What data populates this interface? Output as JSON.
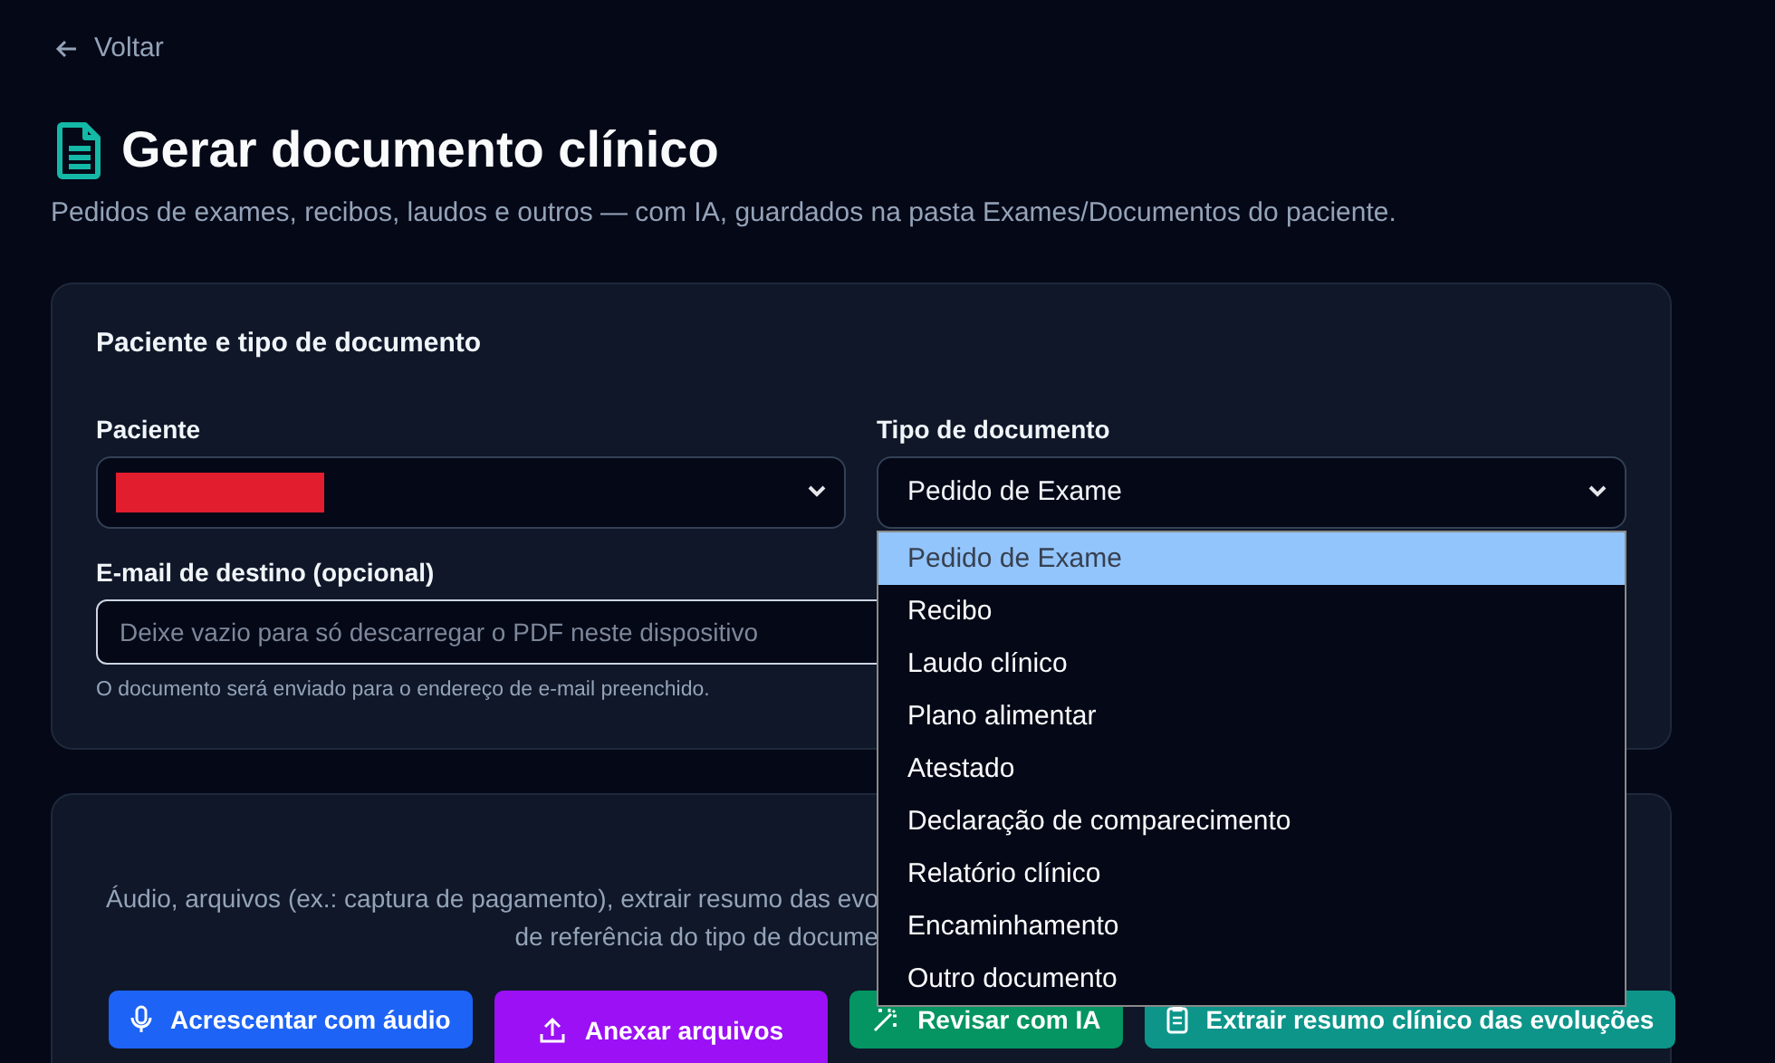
{
  "back_link": {
    "label": "Voltar"
  },
  "title": "Gerar documento clínico",
  "subtitle": "Pedidos de exames, recibos, laudos e outros — com IA, guardados na pasta Exames/Documentos do paciente.",
  "patient_section": {
    "heading": "Paciente e tipo de documento",
    "patient_field": {
      "label": "Paciente",
      "redacted": true
    },
    "type_field": {
      "label": "Tipo de documento",
      "value": "Pedido de Exame",
      "expanded": true,
      "options": [
        {
          "label": "Pedido de Exame",
          "selected": true
        },
        {
          "label": "Recibo",
          "selected": false
        },
        {
          "label": "Laudo clínico",
          "selected": false
        },
        {
          "label": "Plano alimentar",
          "selected": false
        },
        {
          "label": "Atestado",
          "selected": false
        },
        {
          "label": "Declaração de comparecimento",
          "selected": false
        },
        {
          "label": "Relatório clínico",
          "selected": false
        },
        {
          "label": "Encaminhamento",
          "selected": false
        },
        {
          "label": "Outro documento",
          "selected": false
        }
      ]
    },
    "email_field": {
      "label": "E-mail de destino (opcional)",
      "placeholder": "Deixe vazio para só descarregar o PDF neste dispositivo",
      "hint": "O documento será enviado para o endereço de e-mail preenchido."
    }
  },
  "tools_section": {
    "description_lines": [
      "Áudio, arquivos (ex.: captura de pagamento), extrair resumo das evo",
      "de referência do tipo de docume"
    ],
    "buttons": [
      {
        "label": "Acrescentar com áudio",
        "kind": "audio"
      },
      {
        "label": "Anexar arquivos",
        "kind": "attach"
      },
      {
        "label": "Revisar com IA",
        "kind": "review"
      },
      {
        "label": "Extrair resumo clínico das evoluções",
        "kind": "extract"
      }
    ]
  }
}
